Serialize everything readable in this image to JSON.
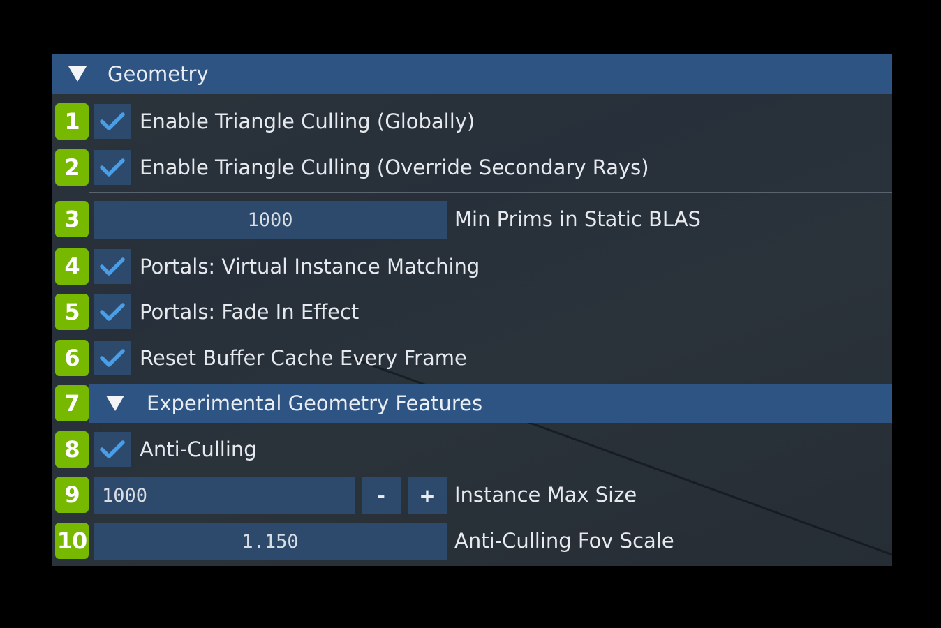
{
  "section": {
    "title": "Geometry",
    "expanded": true
  },
  "rows": [
    {
      "badge": "1",
      "type": "checkbox",
      "checked": true,
      "label": "Enable Triangle Culling (Globally)"
    },
    {
      "badge": "2",
      "type": "checkbox",
      "checked": true,
      "label": "Enable Triangle Culling (Override Secondary Rays)"
    },
    {
      "badge": "3",
      "type": "slider",
      "value": "1000",
      "label": "Min Prims in Static BLAS"
    },
    {
      "badge": "4",
      "type": "checkbox",
      "checked": true,
      "label": "Portals: Virtual Instance Matching"
    },
    {
      "badge": "5",
      "type": "checkbox",
      "checked": true,
      "label": "Portals: Fade In Effect"
    },
    {
      "badge": "6",
      "type": "checkbox",
      "checked": true,
      "label": "Reset Buffer Cache Every Frame"
    },
    {
      "badge": "7",
      "type": "collapsing-header",
      "expanded": true,
      "label": "Experimental Geometry Features"
    },
    {
      "badge": "8",
      "type": "checkbox",
      "checked": true,
      "label": "Anti-Culling"
    },
    {
      "badge": "9",
      "type": "input-int",
      "value": "1000",
      "minus": "-",
      "plus": "+",
      "label": "Instance Max Size"
    },
    {
      "badge": "10",
      "type": "slider",
      "value": "1.150",
      "label": "Anti-Culling Fov Scale"
    }
  ],
  "colors": {
    "badge": "#76b900",
    "header": "#2e5483",
    "control": "#2d4a6c",
    "check": "#4a9ee8"
  },
  "icons": {
    "expand": "triangle-down-icon",
    "check": "checkmark-icon"
  }
}
